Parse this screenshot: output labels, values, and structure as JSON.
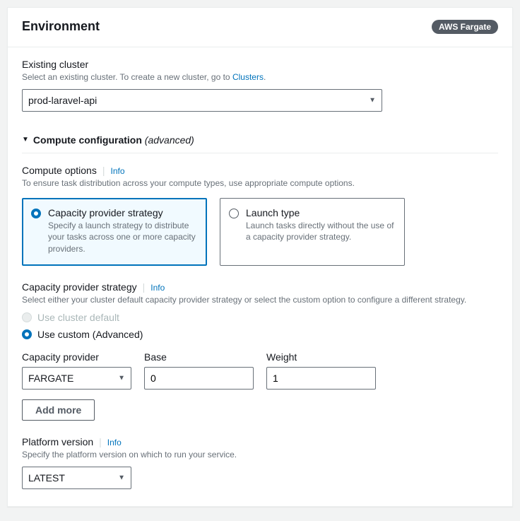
{
  "header": {
    "title": "Environment",
    "badge": "AWS Fargate"
  },
  "existingCluster": {
    "label": "Existing cluster",
    "help_prefix": "Select an existing cluster. To create a new cluster, go to ",
    "help_link": "Clusters",
    "help_suffix": ".",
    "value": "prod-laravel-api"
  },
  "computeConfig": {
    "expander_bold": "Compute configuration",
    "expander_ital": "(advanced)"
  },
  "computeOptions": {
    "label": "Compute options",
    "info": "Info",
    "help": "To ensure task distribution across your compute types, use appropriate compute options.",
    "tiles": [
      {
        "title": "Capacity provider strategy",
        "desc": "Specify a launch strategy to distribute your tasks across one or more capacity providers.",
        "selected": true
      },
      {
        "title": "Launch type",
        "desc": "Launch tasks directly without the use of a capacity provider strategy.",
        "selected": false
      }
    ]
  },
  "capacityStrategy": {
    "label": "Capacity provider strategy",
    "info": "Info",
    "help": "Select either your cluster default capacity provider strategy or select the custom option to configure a different strategy.",
    "options": [
      {
        "label": "Use cluster default",
        "disabled": true,
        "selected": false
      },
      {
        "label": "Use custom (Advanced)",
        "disabled": false,
        "selected": true
      }
    ]
  },
  "providerRow": {
    "capacity_label": "Capacity provider",
    "capacity_value": "FARGATE",
    "base_label": "Base",
    "base_value": "0",
    "weight_label": "Weight",
    "weight_value": "1"
  },
  "addMore": "Add more",
  "platform": {
    "label": "Platform version",
    "info": "Info",
    "help": "Specify the platform version on which to run your service.",
    "value": "LATEST"
  }
}
